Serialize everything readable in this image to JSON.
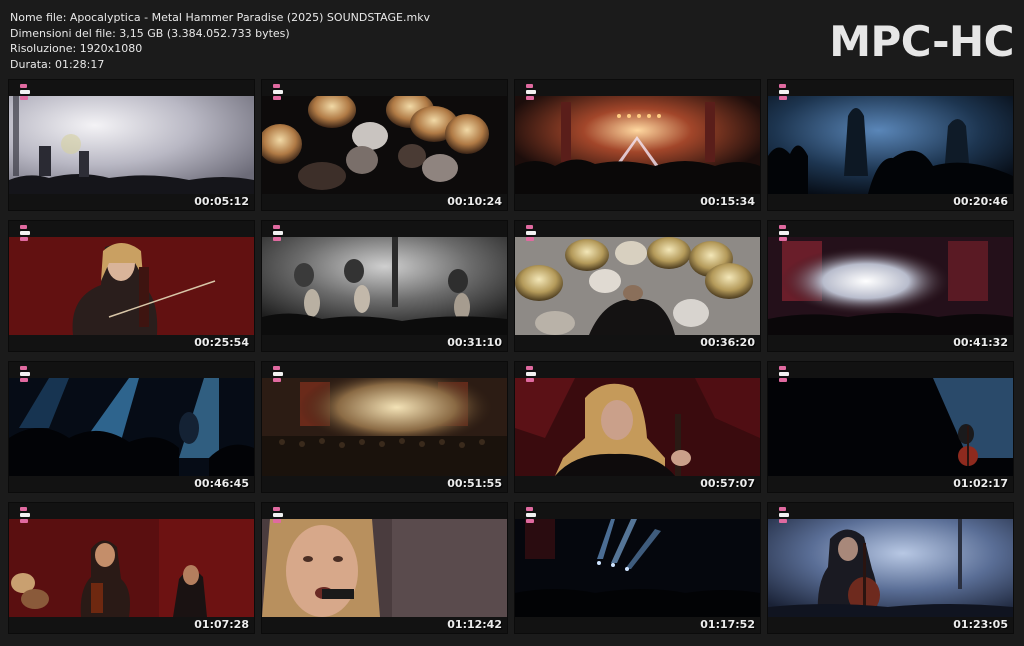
{
  "file_info": {
    "name": "Nome file: Apocalyptica - Metal Hammer Paradise (2025) SOUNDSTAGE.mkv",
    "size": "Dimensioni del file: 3,15 GB (3.384.052.733 bytes)",
    "resolution": "Risoluzione: 1920x1080",
    "duration": "Durata: 01:28:17"
  },
  "logo": "MPC-HC",
  "thumbnails": [
    {
      "time": "00:05:12",
      "scene": "hazy-stage-white"
    },
    {
      "time": "00:10:24",
      "scene": "drum-cymbals-overhead"
    },
    {
      "time": "00:15:34",
      "scene": "stage-lights-orange"
    },
    {
      "time": "00:20:46",
      "scene": "blue-silhouettes"
    },
    {
      "time": "00:25:54",
      "scene": "cellist-red"
    },
    {
      "time": "00:31:10",
      "scene": "three-cellists-grey"
    },
    {
      "time": "00:36:20",
      "scene": "drummer-overhead"
    },
    {
      "time": "00:41:32",
      "scene": "wide-stage-red-white"
    },
    {
      "time": "00:46:45",
      "scene": "blue-spotlights-crowd"
    },
    {
      "time": "00:51:55",
      "scene": "wide-stage-amber"
    },
    {
      "time": "00:57:07",
      "scene": "cellist-closeup-red"
    },
    {
      "time": "01:02:17",
      "scene": "cellist-spotlight-dark"
    },
    {
      "time": "01:07:28",
      "scene": "band-red-stage"
    },
    {
      "time": "01:12:42",
      "scene": "singer-closeup"
    },
    {
      "time": "01:17:52",
      "scene": "dark-stage-blue-beams"
    },
    {
      "time": "01:23:05",
      "scene": "cellist-blue-haze"
    }
  ]
}
